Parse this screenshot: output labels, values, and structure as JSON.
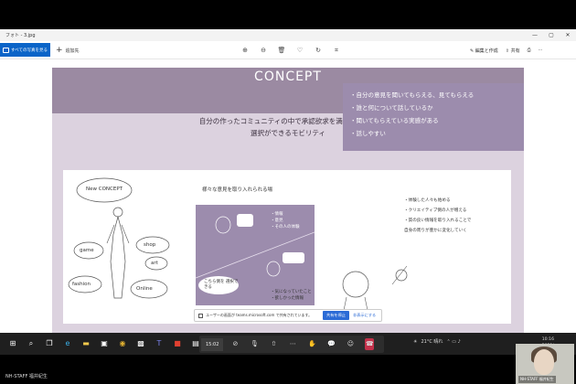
{
  "window": {
    "title": "フォト - 3.jpg",
    "controls": [
      "—",
      "▢",
      "✕"
    ]
  },
  "toolbar": {
    "all_photos_label": "すべての写真を見る",
    "add_label": "追加先",
    "tools": [
      "zoom-in-icon",
      "zoom-out-icon",
      "delete-icon",
      "favorite-icon",
      "rotate-icon",
      "crop-icon"
    ],
    "edit_label": "編集と作成",
    "share_label": "共有"
  },
  "slide": {
    "title": "CONCEPT",
    "subtitle_line1": "自分の作ったコミュニティの中で承認欲求を満たしながら",
    "subtitle_line2": "選択ができるモビリティ",
    "sketch_words": {
      "new_concept": "New CONCEPT",
      "game": "game",
      "shop": "shop",
      "art": "art",
      "fashion": "fashion",
      "online": "Online"
    },
    "panel_heading": "様々な意見を取り入れられる場",
    "panel_items": [
      "・情報",
      "・意見",
      "・その人の体験"
    ],
    "panel_bottom_items": [
      "・気になっていたこと",
      "・欲しかった情報"
    ],
    "bubble_text": "こちら側を 選択できる",
    "right_box_items": [
      "・自分の意見を聞いてもらえる、見てもらえる",
      "・誰と何について話しているか",
      "・聞いてもらえている実感がある",
      "・話しやすい"
    ],
    "right_list": [
      "・体験した人々も始める",
      "・クリエイティブ側の人が増える",
      "・質の良い情報を取り入れることで",
      "自身の周りが豊かに変化していく"
    ]
  },
  "toast": {
    "message": "ユーザーの画面が teams.microsoft.com で共有されています。",
    "stop_label": "共有を停止",
    "hide_label": "非表示にする"
  },
  "meeting": {
    "time": "15:02"
  },
  "tray": {
    "weather": "21°C 晴れ",
    "time": "10:16",
    "date": "2021/"
  },
  "bottom": {
    "name": "NH-STAFF 福井紀生"
  },
  "thumbnail": {
    "name": "NH-STAFF 福井紀生"
  }
}
